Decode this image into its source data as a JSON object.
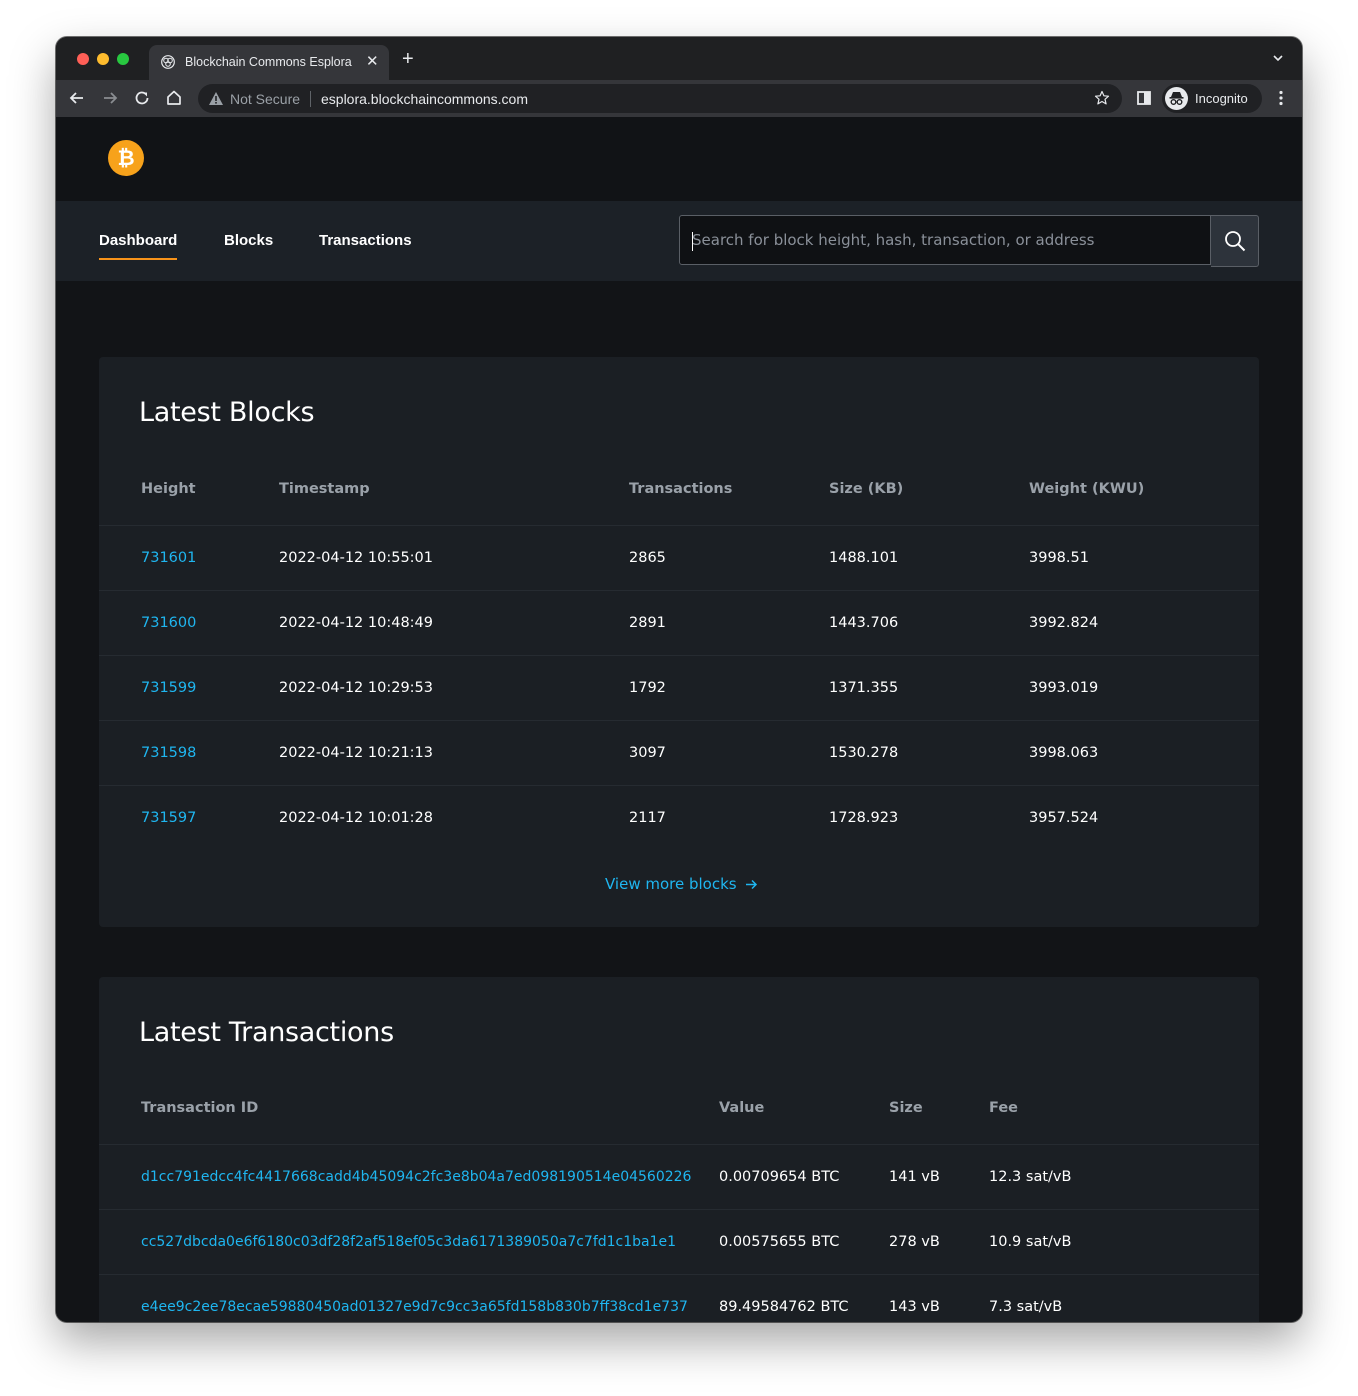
{
  "browser": {
    "tab_title": "Blockchain Commons Esplora",
    "not_secure_label": "Not Secure",
    "url": "esplora.blockchaincommons.com",
    "incognito_label": "Incognito"
  },
  "site": {
    "logo_symbol": "₿",
    "nav": [
      {
        "label": "Dashboard",
        "active": true
      },
      {
        "label": "Blocks",
        "active": false
      },
      {
        "label": "Transactions",
        "active": false
      }
    ],
    "search": {
      "placeholder": "Search for block height, hash, transaction, or address",
      "value": ""
    }
  },
  "colors": {
    "accent": "#f7931a",
    "link": "#1fb6f0",
    "background": "#121417",
    "card": "#1b1f24"
  },
  "latest_blocks": {
    "title": "Latest Blocks",
    "columns": [
      "Height",
      "Timestamp",
      "Transactions",
      "Size (KB)",
      "Weight (KWU)"
    ],
    "rows": [
      [
        "731601",
        "2022-04-12 10:55:01",
        "2865",
        "1488.101",
        "3998.51"
      ],
      [
        "731600",
        "2022-04-12 10:48:49",
        "2891",
        "1443.706",
        "3992.824"
      ],
      [
        "731599",
        "2022-04-12 10:29:53",
        "1792",
        "1371.355",
        "3993.019"
      ],
      [
        "731598",
        "2022-04-12 10:21:13",
        "3097",
        "1530.278",
        "3998.063"
      ],
      [
        "731597",
        "2022-04-12 10:01:28",
        "2117",
        "1728.923",
        "3957.524"
      ]
    ],
    "view_more_label": "View more blocks"
  },
  "latest_transactions": {
    "title": "Latest Transactions",
    "columns": [
      "Transaction ID",
      "Value",
      "Size",
      "Fee"
    ],
    "rows": [
      [
        "d1cc791edcc4fc4417668cadd4b45094c2fc3e8b04a7ed098190514e04560226",
        "0.00709654 BTC",
        "141 vB",
        "12.3 sat/vB"
      ],
      [
        "cc527dbcda0e6f6180c03df28f2af518ef05c3da6171389050a7c7fd1c1ba1e1",
        "0.00575655 BTC",
        "278 vB",
        "10.9 sat/vB"
      ],
      [
        "e4ee9c2ee78ecae59880450ad01327e9d7c9cc3a65fd158b830b7ff38cd1e737",
        "89.49584762 BTC",
        "143 vB",
        "7.3 sat/vB"
      ]
    ]
  }
}
